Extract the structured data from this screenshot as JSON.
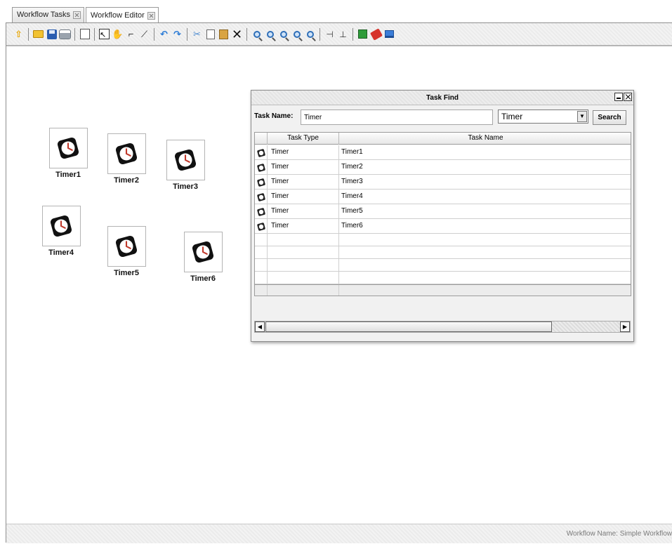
{
  "tabs": [
    {
      "label": "Workflow Tasks"
    },
    {
      "label": "Workflow Editor"
    }
  ],
  "toolbar": {
    "icons": [
      "up-icon",
      "open-folder-icon",
      "save-icon",
      "print-icon",
      "preview-icon",
      "select-icon",
      "pan-hand-icon",
      "connector-icon",
      "line-icon",
      "undo-icon",
      "redo-icon",
      "cut-icon",
      "copy-icon",
      "paste-icon",
      "delete-icon",
      "zoom-icon",
      "zoom-in-icon",
      "zoom-out-icon",
      "zoom-fit-icon",
      "zoom-actual-icon",
      "align-icon",
      "tree-layout-icon",
      "grid-icon",
      "properties-icon",
      "display-icon"
    ]
  },
  "canvas": {
    "nodes": [
      {
        "label": "Timer1"
      },
      {
        "label": "Timer2"
      },
      {
        "label": "Timer3"
      },
      {
        "label": "Timer4"
      },
      {
        "label": "Timer5"
      },
      {
        "label": "Timer6"
      }
    ]
  },
  "dialog": {
    "title": "Task Find",
    "search_label": "Task Name:",
    "search_value": "Timer",
    "type_select": "Timer",
    "search_button": "Search",
    "columns": [
      "Task Type",
      "Task Name"
    ],
    "rows": [
      {
        "type": "Timer",
        "name": "Timer1"
      },
      {
        "type": "Timer",
        "name": "Timer2"
      },
      {
        "type": "Timer",
        "name": "Timer3"
      },
      {
        "type": "Timer",
        "name": "Timer4"
      },
      {
        "type": "Timer",
        "name": "Timer5"
      },
      {
        "type": "Timer",
        "name": "Timer6"
      }
    ]
  },
  "status": {
    "workflow_name": "Workflow Name: Simple Workflow"
  }
}
